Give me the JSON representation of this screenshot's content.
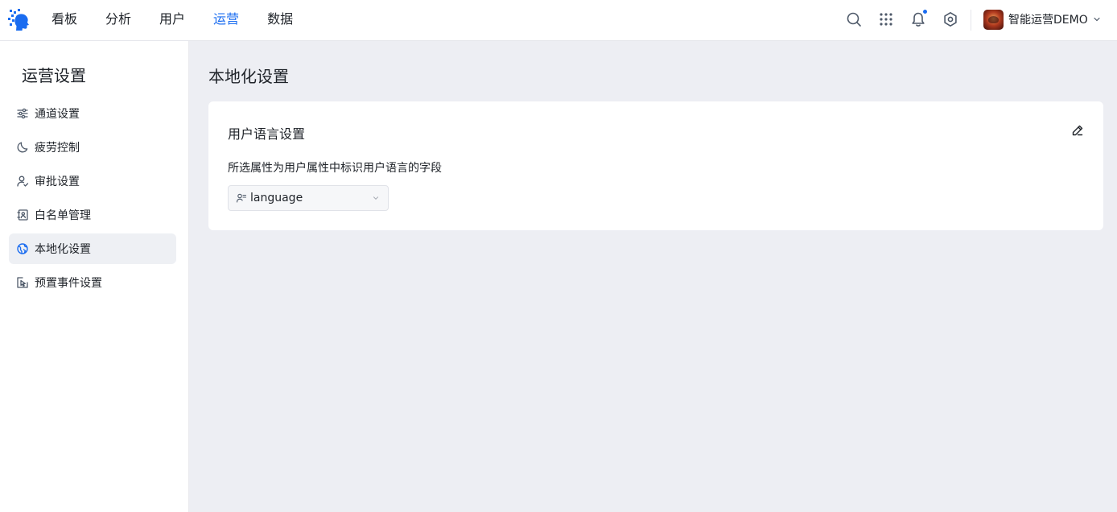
{
  "nav": {
    "items": [
      {
        "label": "看板"
      },
      {
        "label": "分析"
      },
      {
        "label": "用户"
      },
      {
        "label": "运营",
        "active": true
      },
      {
        "label": "数据"
      }
    ]
  },
  "header": {
    "icons": [
      "search-icon",
      "apps-grid-icon",
      "bell-icon",
      "gear-icon"
    ],
    "account_name": "智能运营DEMO",
    "accent_color": "#1a6cf0"
  },
  "sidebar": {
    "title": "运营设置",
    "items": [
      {
        "label": "通道设置",
        "icon": "sliders-icon"
      },
      {
        "label": "疲劳控制",
        "icon": "moon-icon"
      },
      {
        "label": "审批设置",
        "icon": "user-check-icon"
      },
      {
        "label": "白名单管理",
        "icon": "contact-card-icon"
      },
      {
        "label": "本地化设置",
        "icon": "globe-icon",
        "active": true
      },
      {
        "label": "预置事件设置",
        "icon": "event-cursor-icon"
      }
    ]
  },
  "main": {
    "page_title": "本地化设置",
    "card": {
      "title": "用户语言设置",
      "description": "所选属性为用户属性中标识用户语言的字段",
      "select": {
        "value": "language",
        "icon": "user-attribute-icon"
      }
    }
  }
}
